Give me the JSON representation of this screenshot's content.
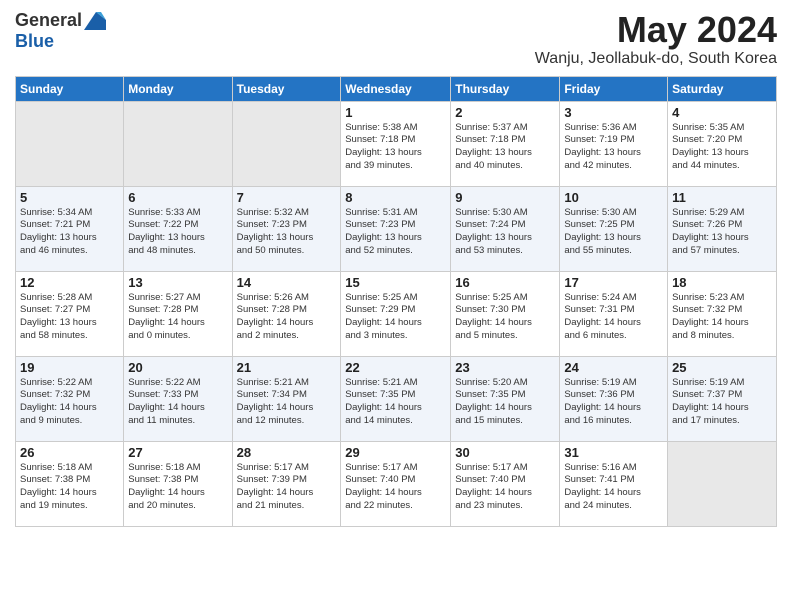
{
  "header": {
    "logo_general": "General",
    "logo_blue": "Blue",
    "month_title": "May 2024",
    "location": "Wanju, Jeollabuk-do, South Korea"
  },
  "days_of_week": [
    "Sunday",
    "Monday",
    "Tuesday",
    "Wednesday",
    "Thursday",
    "Friday",
    "Saturday"
  ],
  "weeks": [
    [
      {
        "day": "",
        "info": ""
      },
      {
        "day": "",
        "info": ""
      },
      {
        "day": "",
        "info": ""
      },
      {
        "day": "1",
        "info": "Sunrise: 5:38 AM\nSunset: 7:18 PM\nDaylight: 13 hours\nand 39 minutes."
      },
      {
        "day": "2",
        "info": "Sunrise: 5:37 AM\nSunset: 7:18 PM\nDaylight: 13 hours\nand 40 minutes."
      },
      {
        "day": "3",
        "info": "Sunrise: 5:36 AM\nSunset: 7:19 PM\nDaylight: 13 hours\nand 42 minutes."
      },
      {
        "day": "4",
        "info": "Sunrise: 5:35 AM\nSunset: 7:20 PM\nDaylight: 13 hours\nand 44 minutes."
      }
    ],
    [
      {
        "day": "5",
        "info": "Sunrise: 5:34 AM\nSunset: 7:21 PM\nDaylight: 13 hours\nand 46 minutes."
      },
      {
        "day": "6",
        "info": "Sunrise: 5:33 AM\nSunset: 7:22 PM\nDaylight: 13 hours\nand 48 minutes."
      },
      {
        "day": "7",
        "info": "Sunrise: 5:32 AM\nSunset: 7:23 PM\nDaylight: 13 hours\nand 50 minutes."
      },
      {
        "day": "8",
        "info": "Sunrise: 5:31 AM\nSunset: 7:23 PM\nDaylight: 13 hours\nand 52 minutes."
      },
      {
        "day": "9",
        "info": "Sunrise: 5:30 AM\nSunset: 7:24 PM\nDaylight: 13 hours\nand 53 minutes."
      },
      {
        "day": "10",
        "info": "Sunrise: 5:30 AM\nSunset: 7:25 PM\nDaylight: 13 hours\nand 55 minutes."
      },
      {
        "day": "11",
        "info": "Sunrise: 5:29 AM\nSunset: 7:26 PM\nDaylight: 13 hours\nand 57 minutes."
      }
    ],
    [
      {
        "day": "12",
        "info": "Sunrise: 5:28 AM\nSunset: 7:27 PM\nDaylight: 13 hours\nand 58 minutes."
      },
      {
        "day": "13",
        "info": "Sunrise: 5:27 AM\nSunset: 7:28 PM\nDaylight: 14 hours\nand 0 minutes."
      },
      {
        "day": "14",
        "info": "Sunrise: 5:26 AM\nSunset: 7:28 PM\nDaylight: 14 hours\nand 2 minutes."
      },
      {
        "day": "15",
        "info": "Sunrise: 5:25 AM\nSunset: 7:29 PM\nDaylight: 14 hours\nand 3 minutes."
      },
      {
        "day": "16",
        "info": "Sunrise: 5:25 AM\nSunset: 7:30 PM\nDaylight: 14 hours\nand 5 minutes."
      },
      {
        "day": "17",
        "info": "Sunrise: 5:24 AM\nSunset: 7:31 PM\nDaylight: 14 hours\nand 6 minutes."
      },
      {
        "day": "18",
        "info": "Sunrise: 5:23 AM\nSunset: 7:32 PM\nDaylight: 14 hours\nand 8 minutes."
      }
    ],
    [
      {
        "day": "19",
        "info": "Sunrise: 5:22 AM\nSunset: 7:32 PM\nDaylight: 14 hours\nand 9 minutes."
      },
      {
        "day": "20",
        "info": "Sunrise: 5:22 AM\nSunset: 7:33 PM\nDaylight: 14 hours\nand 11 minutes."
      },
      {
        "day": "21",
        "info": "Sunrise: 5:21 AM\nSunset: 7:34 PM\nDaylight: 14 hours\nand 12 minutes."
      },
      {
        "day": "22",
        "info": "Sunrise: 5:21 AM\nSunset: 7:35 PM\nDaylight: 14 hours\nand 14 minutes."
      },
      {
        "day": "23",
        "info": "Sunrise: 5:20 AM\nSunset: 7:35 PM\nDaylight: 14 hours\nand 15 minutes."
      },
      {
        "day": "24",
        "info": "Sunrise: 5:19 AM\nSunset: 7:36 PM\nDaylight: 14 hours\nand 16 minutes."
      },
      {
        "day": "25",
        "info": "Sunrise: 5:19 AM\nSunset: 7:37 PM\nDaylight: 14 hours\nand 17 minutes."
      }
    ],
    [
      {
        "day": "26",
        "info": "Sunrise: 5:18 AM\nSunset: 7:38 PM\nDaylight: 14 hours\nand 19 minutes."
      },
      {
        "day": "27",
        "info": "Sunrise: 5:18 AM\nSunset: 7:38 PM\nDaylight: 14 hours\nand 20 minutes."
      },
      {
        "day": "28",
        "info": "Sunrise: 5:17 AM\nSunset: 7:39 PM\nDaylight: 14 hours\nand 21 minutes."
      },
      {
        "day": "29",
        "info": "Sunrise: 5:17 AM\nSunset: 7:40 PM\nDaylight: 14 hours\nand 22 minutes."
      },
      {
        "day": "30",
        "info": "Sunrise: 5:17 AM\nSunset: 7:40 PM\nDaylight: 14 hours\nand 23 minutes."
      },
      {
        "day": "31",
        "info": "Sunrise: 5:16 AM\nSunset: 7:41 PM\nDaylight: 14 hours\nand 24 minutes."
      },
      {
        "day": "",
        "info": ""
      }
    ]
  ]
}
